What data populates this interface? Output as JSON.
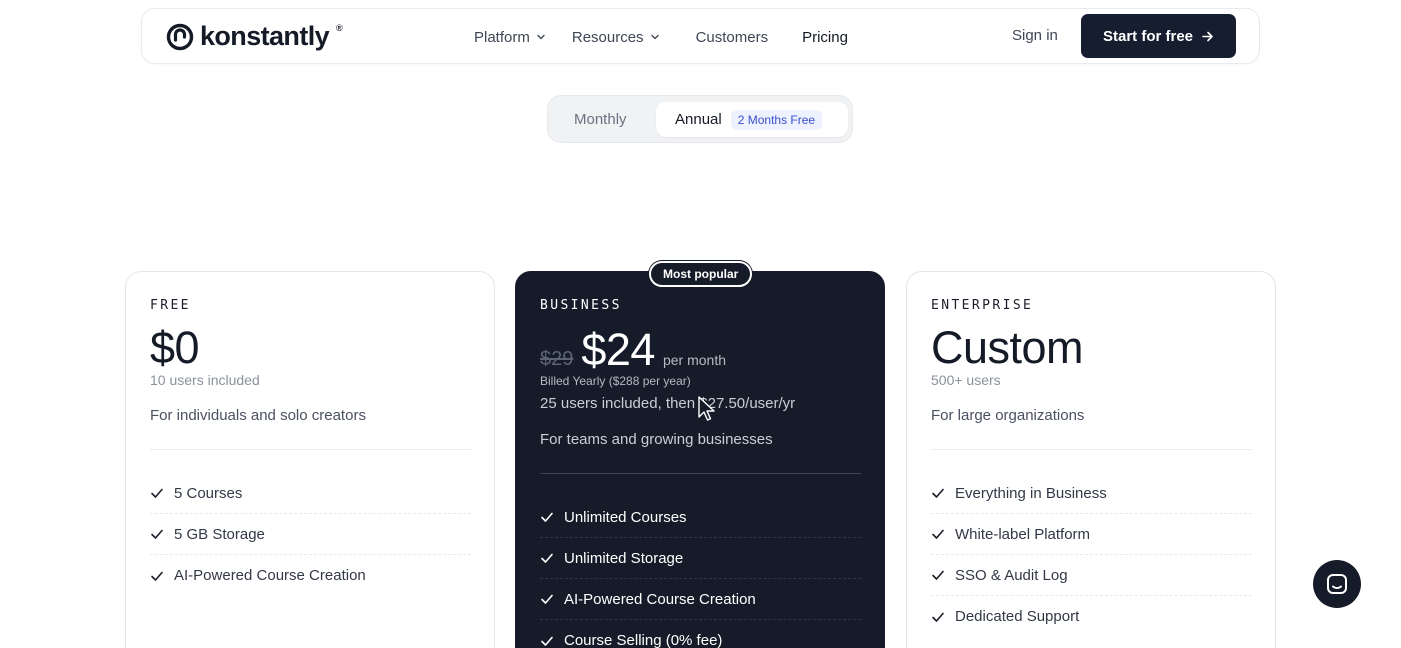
{
  "brand": {
    "name": "konstantly",
    "reg": "®"
  },
  "nav": {
    "items": [
      {
        "label": "Platform",
        "has_dropdown": true
      },
      {
        "label": "Resources",
        "has_dropdown": true
      },
      {
        "label": "Customers",
        "has_dropdown": false
      },
      {
        "label": "Pricing",
        "has_dropdown": false
      }
    ],
    "signin": "Sign in",
    "cta": "Start for free"
  },
  "billing_toggle": {
    "monthly": "Monthly",
    "annual": "Annual",
    "annual_badge": "2 Months Free",
    "selected": "Annual"
  },
  "plans": {
    "free": {
      "tier": "FREE",
      "price": "$0",
      "users": "10 users included",
      "description": "For individuals and solo creators",
      "features": [
        "5 Courses",
        "5 GB Storage",
        "AI-Powered Course Creation"
      ]
    },
    "business": {
      "badge": "Most popular",
      "tier": "BUSINESS",
      "old_price": "$29",
      "price": "$24",
      "period": "per month",
      "billed": "Billed Yearly ($288 per year)",
      "users": "25 users included, then $27.50/user/yr",
      "description": "For teams and growing businesses",
      "features": [
        "Unlimited Courses",
        "Unlimited Storage",
        "AI-Powered Course Creation",
        "Course Selling (0% fee)"
      ]
    },
    "enterprise": {
      "tier": "ENTERPRISE",
      "price": "Custom",
      "users": "500+ users",
      "description": "For large organizations",
      "features": [
        "Everything in Business",
        "White-label Platform",
        "SSO & Audit Log",
        "Dedicated Support"
      ]
    }
  },
  "colors": {
    "primary_dark": "#151b28",
    "badge_bg": "#eef2ff",
    "badge_text": "#3a4fcf"
  }
}
